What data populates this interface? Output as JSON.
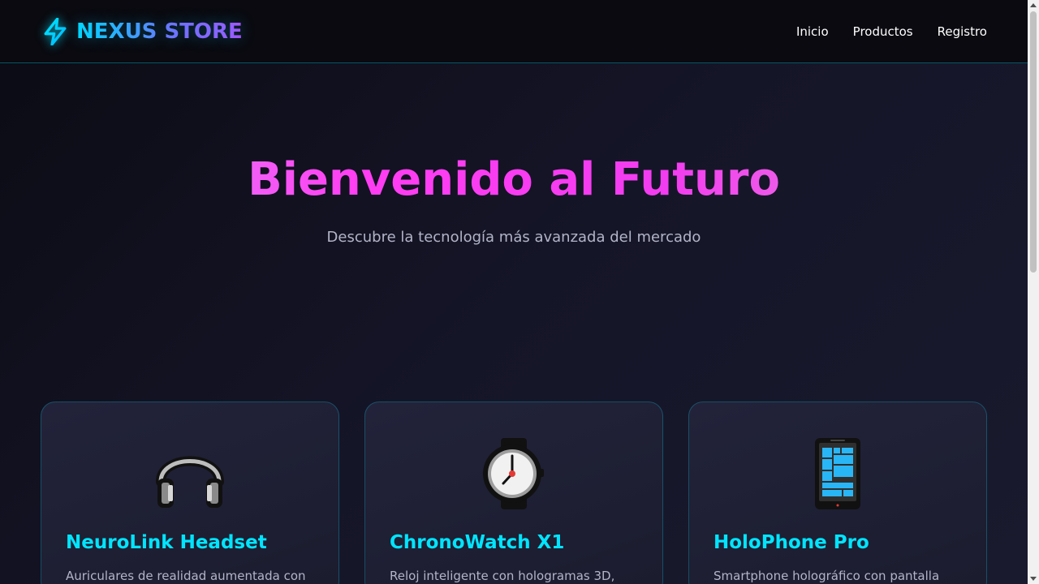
{
  "brand": {
    "name": "NEXUS STORE",
    "icon": "lightning-bolt-icon",
    "colors": {
      "cyan": "#00d9ff",
      "purple": "#b14dff"
    }
  },
  "nav": {
    "links": [
      {
        "label": "Inicio"
      },
      {
        "label": "Productos"
      },
      {
        "label": "Registro"
      }
    ]
  },
  "hero": {
    "title": "Bienvenido al Futuro",
    "subtitle": "Descubre la tecnología más avanzada del mercado"
  },
  "products": [
    {
      "title": "NeuroLink Headset",
      "description": "Auriculares de realidad aumentada con",
      "icon": "headphones-icon"
    },
    {
      "title": "ChronoWatch X1",
      "description": "Reloj inteligente con hologramas 3D,",
      "icon": "watch-icon"
    },
    {
      "title": "HoloPhone Pro",
      "description": "Smartphone holográfico con pantalla",
      "icon": "mobile-phone-icon"
    }
  ],
  "theme": {
    "accent": "#00e5ff",
    "hero_gradient": [
      "#d4a6ff",
      "#ff3df2",
      "#e59ad8"
    ],
    "background": "#151528"
  }
}
